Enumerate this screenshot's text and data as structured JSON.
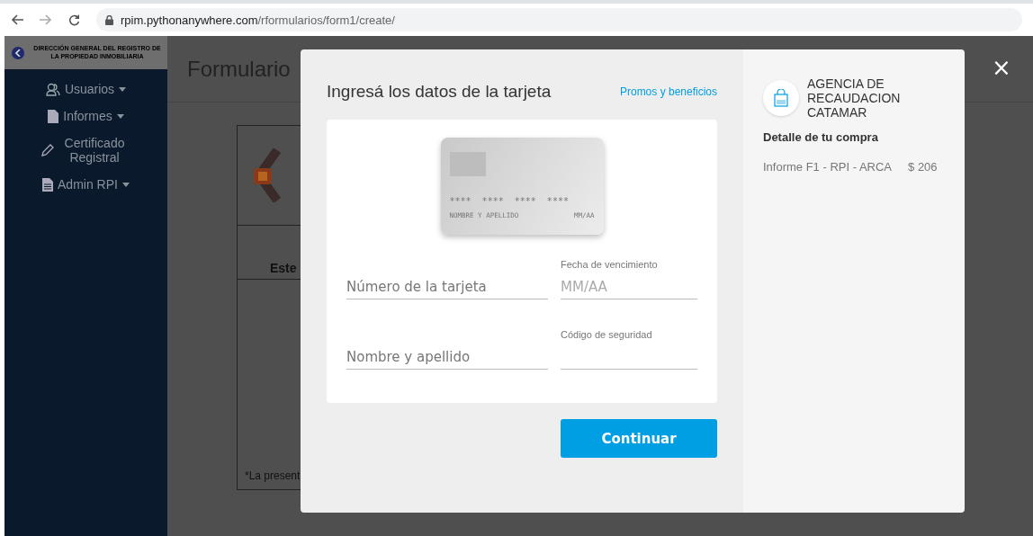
{
  "browser": {
    "url_host": "rpim.pythonanywhere.com",
    "url_path": "/rformularios/form1/create/"
  },
  "header": {
    "logo_text": "DIRECCIÓN GENERAL DEL REGISTRO DE LA PROPIEDAD INMOBILIARIA"
  },
  "sidebar": {
    "items": [
      {
        "label": "Usuarios",
        "kind": "users",
        "dropdown": true
      },
      {
        "label": "Informes",
        "kind": "file",
        "dropdown": true
      },
      {
        "label": "Certificado Registral",
        "kind": "pencil",
        "dropdown": false
      },
      {
        "label": "Admin RPI",
        "kind": "doc",
        "dropdown": true
      }
    ]
  },
  "page": {
    "title": "Formulario",
    "section_text": "Este",
    "footnote": "*La present"
  },
  "modal": {
    "title": "Ingresá los datos de la tarjeta",
    "promo_link": "Promos y beneficios",
    "card": {
      "number": "****  ****  ****  ****",
      "name": "NOMBRE Y APELLIDO",
      "expiry": "MM/AA"
    },
    "fields": [
      {
        "placeholder": "Número de la tarjeta"
      },
      {
        "label": "Fecha de vencimiento",
        "placeholder": "MM/AA"
      },
      {
        "placeholder": "Nombre y apellido"
      },
      {
        "label": "Código de seguridad"
      }
    ],
    "submit": "Continuar",
    "merchant": "AGENCIA DE RECAUDACION CATAMAR",
    "detail_title": "Detalle de tu compra",
    "items": [
      {
        "name": "Informe F1 - RPI - ARCA",
        "price": "$ 206"
      }
    ],
    "close": "×"
  }
}
